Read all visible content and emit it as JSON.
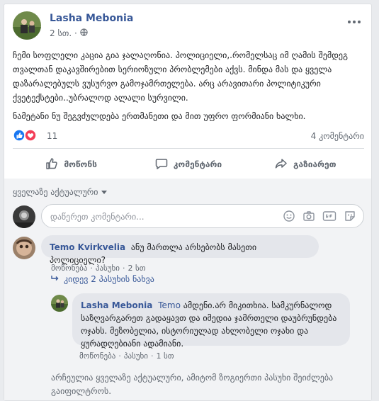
{
  "post": {
    "author": "Lasha Mebonia",
    "time": "2 სთ. ·",
    "paragraphs": [
      "ჩემი სოფლელი კაცია გია ჯალაღონია. პოლიციელი,.რომელსაც იმ ღამის შემდეგ თვალთან დაკავშირებით სერიოზული პრობლემები აქვს. მინდა მას და ყველა დაზარალებულს ვუსურვო გამოჯამრთელება. არც არავითარი პოლიტიკური ქვეტექსტები..უბრალოდ ალალი სურვილი.",
      "ნამეტანი ნუ შეგვძულდება ერთმანეთი და მით უფრო ფორმიანი ხალხი."
    ],
    "reactions_count": "11",
    "comments_count": "4 კომენტარი"
  },
  "actions": {
    "like": "მოწონს",
    "comment": "კომენტარი",
    "share": "გაზიარეთ"
  },
  "comments_section": {
    "sort_label": "ყველაზე აქტუალური",
    "write_placeholder": "დაწერეთ კომენტარი...",
    "comment1": {
      "author": "Temo Kvirkvelia",
      "text": "ანუ მართლა არსებობს მასეთი პოლიციელი?",
      "like": "მოწონება",
      "reply": "პასუხი",
      "time": "2 სთ"
    },
    "view_replies": "კიდევ 2 პასუხის ნახვა",
    "comment2": {
      "author": "Lasha Mebonia",
      "mention": "Temo",
      "text": "ამდენი.არ მიკითხია. სამკურნალოდ საზღვარგარეთ გადაყავთ და იმედია ჯამრთელი დაუბრუნდება ოჯახს. მეზობელია, ისტორიულად ახლობელი ოჯახი და ყურადღებიანი ადამიანი.",
      "like": "მოწონება",
      "reply": "პასუხი",
      "time": "1 სთ"
    },
    "notice": "არჩეულია ყველაზე აქტუალური, ამიტომ ზოგიერთი პასუხი შეიძლება გაიფილტროს."
  },
  "colors": {
    "link": "#385898",
    "like_blue": "#1877f2",
    "love_red": "#f33e58"
  }
}
